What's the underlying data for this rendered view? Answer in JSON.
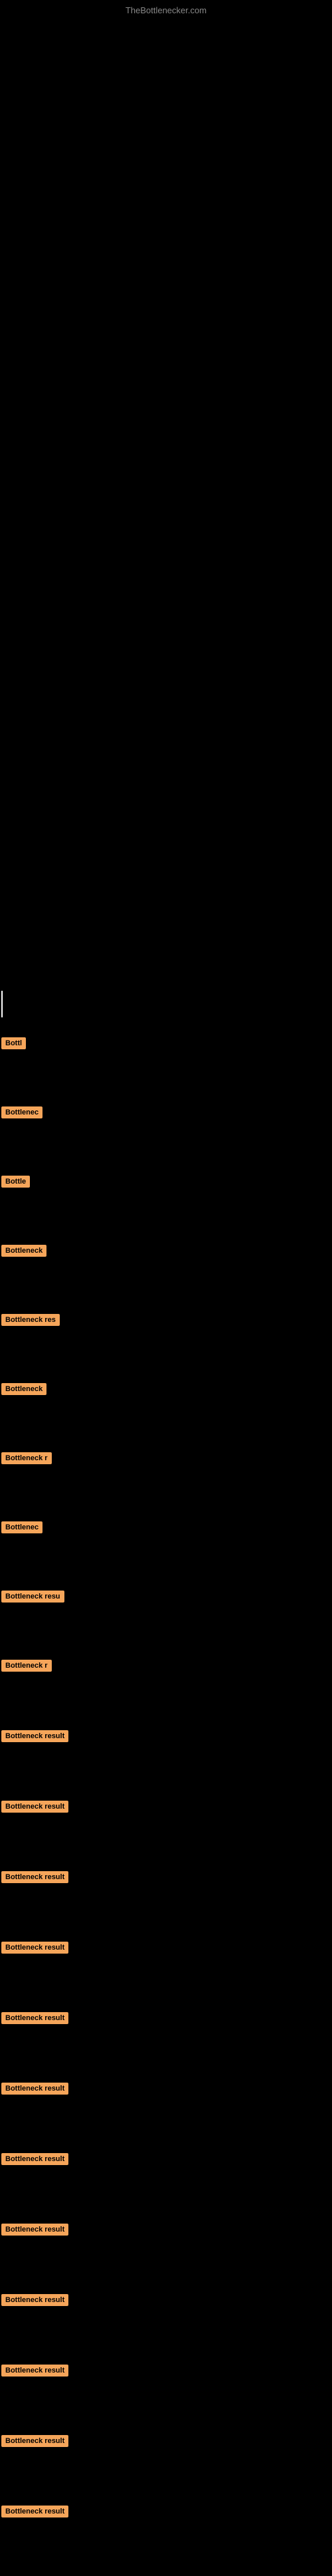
{
  "site": {
    "title": "TheBottlenecker.com"
  },
  "badge": {
    "color": "#f5a55a",
    "text_short_1": "Bottl",
    "text_short_2": "Bottlenec",
    "text_short_3": "Bottle",
    "text_short_4": "Bottleneck",
    "text_medium_1": "Bottleneck res",
    "text_medium_2": "Bottleneck",
    "text_medium_3": "Bottleneck r",
    "text_medium_4": "Bottlenec",
    "text_medium_5": "Bottleneck resu",
    "text_medium_6": "Bottleneck r",
    "text_full": "Bottleneck result"
  },
  "items": [
    {
      "label": "Bottl",
      "width": 40
    },
    {
      "label": "Bottlenec",
      "width": 70
    },
    {
      "label": "Bottle",
      "width": 50
    },
    {
      "label": "Bottleneck",
      "width": 80
    },
    {
      "label": "Bottleneck res",
      "width": 105
    },
    {
      "label": "Bottleneck",
      "width": 80
    },
    {
      "label": "Bottleneck r",
      "width": 90
    },
    {
      "label": "Bottlenec",
      "width": 70
    },
    {
      "label": "Bottleneck resu",
      "width": 110
    },
    {
      "label": "Bottleneck r",
      "width": 90
    },
    {
      "label": "Bottleneck result",
      "width": 120
    },
    {
      "label": "Bottleneck result",
      "width": 120
    },
    {
      "label": "Bottleneck result",
      "width": 120
    },
    {
      "label": "Bottleneck result",
      "width": 120
    },
    {
      "label": "Bottleneck result",
      "width": 120
    },
    {
      "label": "Bottleneck result",
      "width": 120
    },
    {
      "label": "Bottleneck result",
      "width": 120
    },
    {
      "label": "Bottleneck result",
      "width": 120
    },
    {
      "label": "Bottleneck result",
      "width": 120
    },
    {
      "label": "Bottleneck result",
      "width": 120
    },
    {
      "label": "Bottleneck result",
      "width": 120
    },
    {
      "label": "Bottleneck result",
      "width": 120
    }
  ]
}
